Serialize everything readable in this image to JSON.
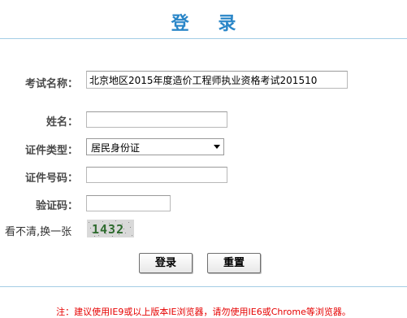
{
  "header": {
    "title": "登 录"
  },
  "form": {
    "exam_name": {
      "label": "考试名称：",
      "value": "北京地区2015年度造价工程师执业资格考试201510"
    },
    "name": {
      "label": "姓名：",
      "value": ""
    },
    "id_type": {
      "label": "证件类型：",
      "selected": "居民身份证"
    },
    "id_number": {
      "label": "证件号码：",
      "value": ""
    },
    "captcha": {
      "label": "验证码：",
      "value": "",
      "refresh_link": "看不清,换一张",
      "image_text": "1432"
    }
  },
  "buttons": {
    "login": "登录",
    "reset": "重置"
  },
  "footer": {
    "notice": "注：建议使用IE9或以上版本IE浏览器，请勿使用IE6或Chrome等浏览器。"
  },
  "colors": {
    "title": "#2a86c8",
    "notice": "#e60000",
    "rule": "#a4cde5"
  }
}
